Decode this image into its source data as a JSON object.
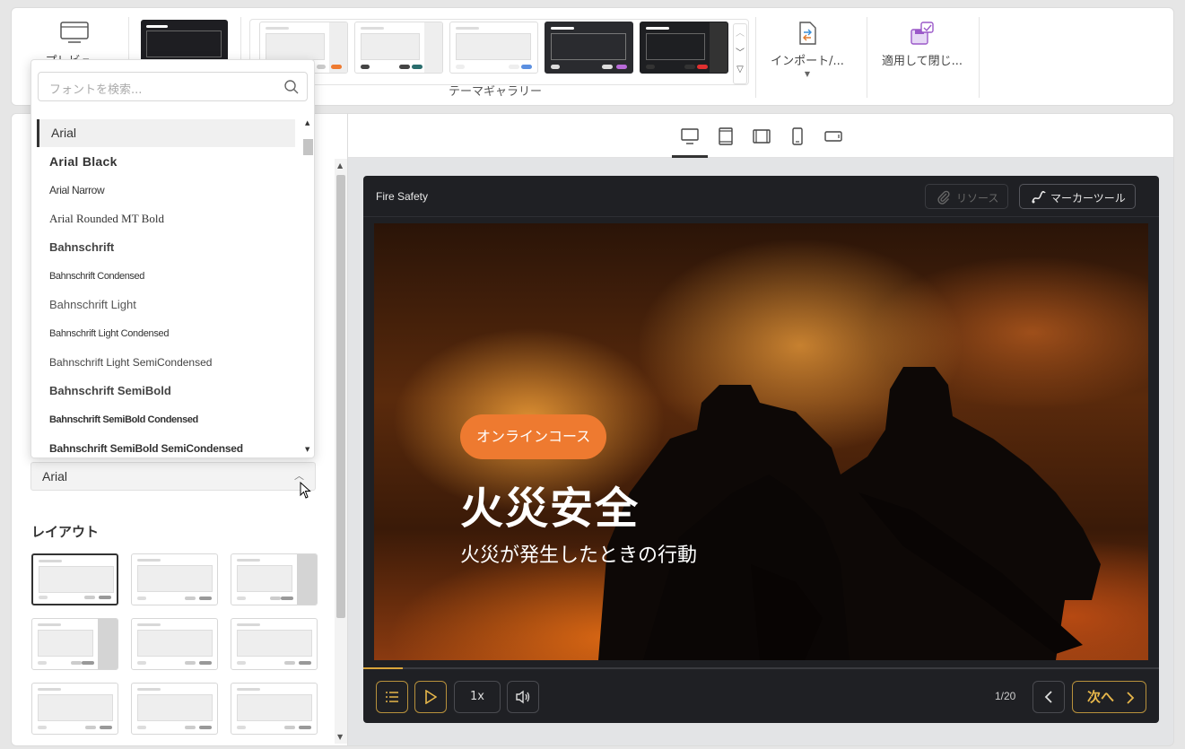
{
  "ribbon": {
    "preview_label": "プレビュー",
    "gallery_label": "テーマギャラリー",
    "import_label": "インポート/...",
    "apply_close_label": "適用して閉じ..."
  },
  "font_dropdown": {
    "search_placeholder": "フォントを検索...",
    "fonts": [
      "Arial",
      "Arial Black",
      "Arial Narrow",
      "Arial Rounded MT Bold",
      "Bahnschrift",
      "Bahnschrift Condensed",
      "Bahnschrift Light",
      "Bahnschrift Light Condensed",
      "Bahnschrift Light SemiCondensed",
      "Bahnschrift SemiBold",
      "Bahnschrift SemiBold Condensed",
      "Bahnschrift SemiBold SemiCondensed"
    ]
  },
  "left": {
    "font_selected": "Arial",
    "layout_title": "レイアウト"
  },
  "player": {
    "title": "Fire Safety",
    "resources_label": "リソース",
    "marker_label": "マーカーツール",
    "pill": "オンラインコース",
    "slide_title": "火災安全",
    "slide_subtitle": "火災が発生したときの行動",
    "speed": "1x",
    "page": "1/20",
    "next_label": "次へ",
    "progress_fraction": 0.05
  },
  "colors": {
    "accent_orange": "#ee7a30",
    "gold": "#d9a53b",
    "player_bg": "#1f2024"
  }
}
